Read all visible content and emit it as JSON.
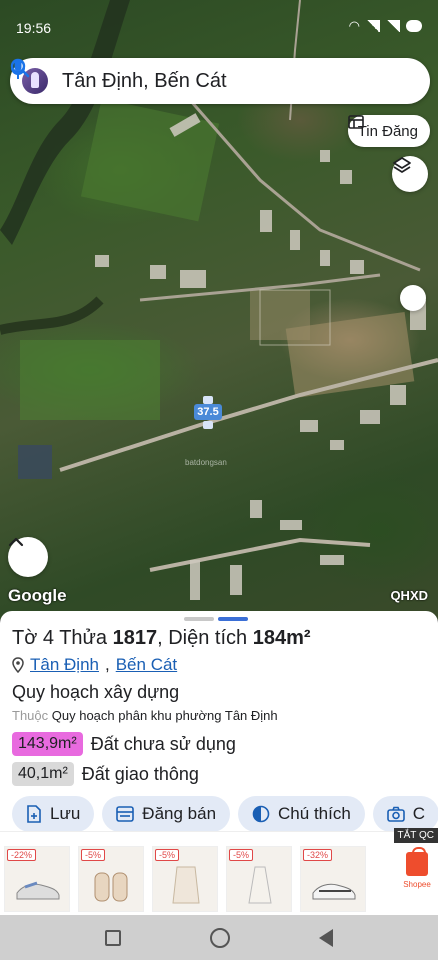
{
  "status": {
    "time": "19:56"
  },
  "search": {
    "text": "Tân Định, Bến Cát"
  },
  "map": {
    "tin_dang_label": "Tin Đăng",
    "road_label": "37.5",
    "watermark": "batdongsan",
    "google_logo": "Google",
    "layer_code": "QHXD"
  },
  "parcel": {
    "title_prefix": "Tờ 4 Thửa ",
    "plot_number": "1817",
    "area_text": ", Diện tích ",
    "area_value": "184m²",
    "ward": "Tân Định",
    "district": "Bến Cát",
    "separator": ",",
    "plan_title": "Quy hoạch xây dựng",
    "plan_belongs": "Thuộc",
    "plan_name": "Quy hoạch phân khu phường Tân Định",
    "areas": [
      {
        "value": "143,9m²",
        "label": "Đất chưa sử dụng",
        "color": "#e86adf"
      },
      {
        "value": "40,1m²",
        "label": "Đất giao thông",
        "color": "#d9d9d9"
      }
    ],
    "actions": [
      {
        "label": "Lưu",
        "icon": "save-icon"
      },
      {
        "label": "Đăng bán",
        "icon": "post-icon"
      },
      {
        "label": "Chú thích",
        "icon": "legend-icon"
      },
      {
        "label": "C",
        "icon": "camera-icon"
      }
    ]
  },
  "ad": {
    "close_label": "TẮT QC",
    "items": [
      {
        "badge": "-22%"
      },
      {
        "badge": "-5%"
      },
      {
        "badge": "-5%"
      },
      {
        "badge": "-5%"
      },
      {
        "badge": "-32%"
      }
    ],
    "brand": "Shopee"
  }
}
